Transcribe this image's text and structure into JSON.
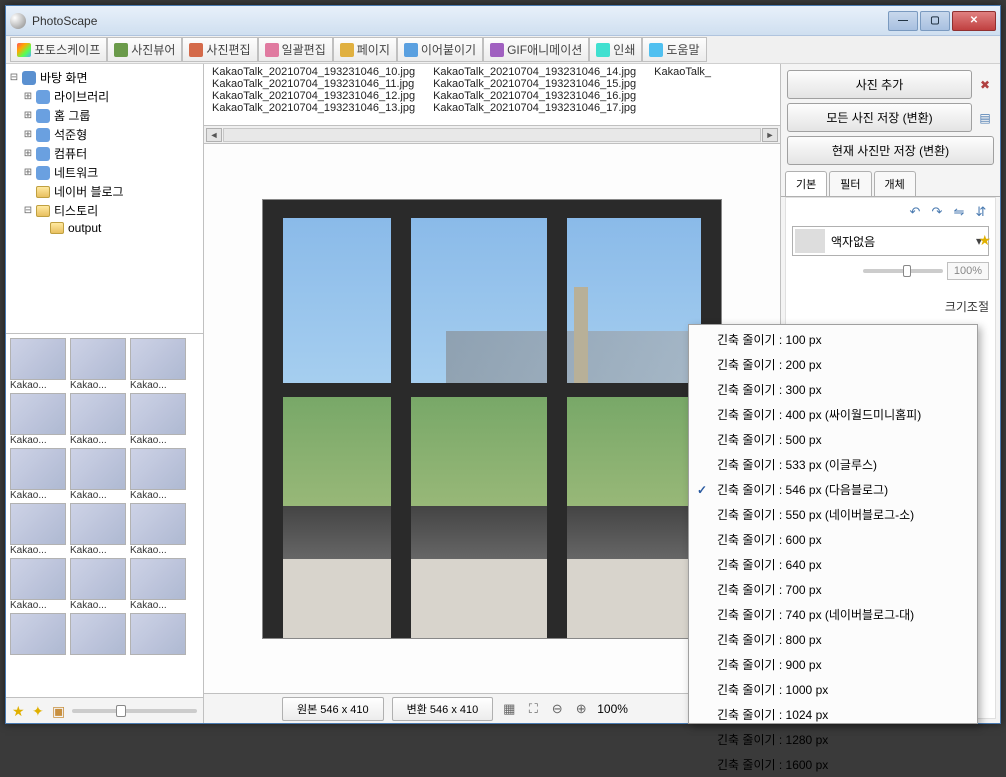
{
  "titlebar": {
    "title": "PhotoScape"
  },
  "toolbar": {
    "tabs": [
      {
        "label": "포토스케이프"
      },
      {
        "label": "사진뷰어"
      },
      {
        "label": "사진편집"
      },
      {
        "label": "일괄편집"
      },
      {
        "label": "페이지"
      },
      {
        "label": "이어붙이기"
      },
      {
        "label": "GIF애니메이션"
      },
      {
        "label": "인쇄"
      },
      {
        "label": "도움말"
      }
    ]
  },
  "tree": {
    "root": "바탕 화면",
    "nodes": [
      {
        "label": "라이브러리",
        "icon": "special"
      },
      {
        "label": "홈 그룹",
        "icon": "special"
      },
      {
        "label": "석준형",
        "icon": "special"
      },
      {
        "label": "컴퓨터",
        "icon": "special"
      },
      {
        "label": "네트워크",
        "icon": "special"
      },
      {
        "label": "네이버 블로그",
        "icon": "folder"
      },
      {
        "label": "티스토리",
        "icon": "folder",
        "children": [
          {
            "label": "output",
            "icon": "folder"
          }
        ]
      }
    ]
  },
  "thumbs": {
    "label": "Kakao..."
  },
  "filelist": {
    "col1": [
      "KakaoTalk_20210704_193231046_10.jpg",
      "KakaoTalk_20210704_193231046_11.jpg",
      "KakaoTalk_20210704_193231046_12.jpg",
      "KakaoTalk_20210704_193231046_13.jpg"
    ],
    "col2": [
      "KakaoTalk_20210704_193231046_14.jpg",
      "KakaoTalk_20210704_193231046_15.jpg",
      "KakaoTalk_20210704_193231046_16.jpg",
      "KakaoTalk_20210704_193231046_17.jpg"
    ],
    "col3": [
      "KakaoTalk_"
    ]
  },
  "right": {
    "btn_add": "사진 추가",
    "btn_save_all": "모든 사진 저장 (변환)",
    "btn_save_current": "현재 사진만 저장 (변환)",
    "tabs": [
      {
        "label": "기본"
      },
      {
        "label": "필터"
      },
      {
        "label": "개체"
      }
    ],
    "frame_none": "액자없음",
    "pct": "100%",
    "resize_label": "크기조절"
  },
  "bottom": {
    "orig": "원본 546 x 410",
    "conv": "변환 546 x 410",
    "zoom": "100%"
  },
  "menu": {
    "items": [
      {
        "label": "긴축 줄이기 : 100 px"
      },
      {
        "label": "긴축 줄이기 : 200 px"
      },
      {
        "label": "긴축 줄이기 : 300 px"
      },
      {
        "label": "긴축 줄이기 : 400 px (싸이월드미니홈피)"
      },
      {
        "label": "긴축 줄이기 : 500 px"
      },
      {
        "label": "긴축 줄이기 : 533 px (이글루스)"
      },
      {
        "label": "긴축 줄이기 : 546 px (다음블로그)",
        "checked": true
      },
      {
        "label": "긴축 줄이기 : 550 px (네이버블로그-소)"
      },
      {
        "label": "긴축 줄이기 : 600 px"
      },
      {
        "label": "긴축 줄이기 : 640 px"
      },
      {
        "label": "긴축 줄이기 : 700 px"
      },
      {
        "label": "긴축 줄이기 : 740 px (네이버블로그-대)"
      },
      {
        "label": "긴축 줄이기 : 800 px"
      },
      {
        "label": "긴축 줄이기 : 900 px"
      },
      {
        "label": "긴축 줄이기 : 1000 px"
      },
      {
        "label": "긴축 줄이기 : 1024 px"
      },
      {
        "label": "긴축 줄이기 : 1280 px"
      },
      {
        "label": "긴축 줄이기 : 1600 px"
      }
    ]
  }
}
